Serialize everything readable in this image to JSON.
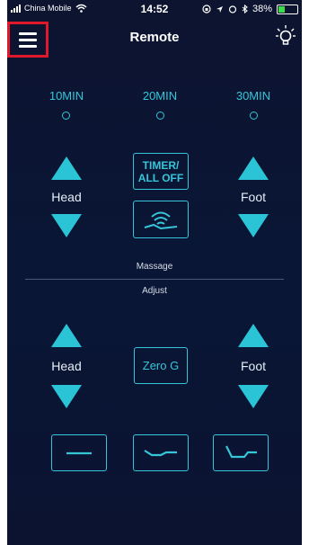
{
  "status_bar": {
    "carrier": "China Mobile",
    "time": "14:52",
    "battery": "38%",
    "battery_level": 0.38
  },
  "header": {
    "title": "Remote",
    "menu_icon": "hamburger-menu-icon",
    "light_icon": "light-bulb-icon"
  },
  "timers": [
    "10MIN",
    "20MIN",
    "30MIN"
  ],
  "massage_section": {
    "left_label": "Head",
    "right_label": "Foot",
    "timer_button": [
      "TIMER/",
      "ALL OFF"
    ],
    "wave_icon": "massage-wave-icon",
    "section_label": "Massage"
  },
  "adjust_section": {
    "section_label": "Adjust",
    "left_label": "Head",
    "right_label": "Foot",
    "center_button": "Zero G",
    "presets": [
      "flat-position-icon",
      "lounge-position-icon",
      "incline-position-icon"
    ]
  },
  "colors": {
    "accent": "#2bc4d6",
    "background": "#0c1430",
    "highlight_border": "#e0192a"
  }
}
